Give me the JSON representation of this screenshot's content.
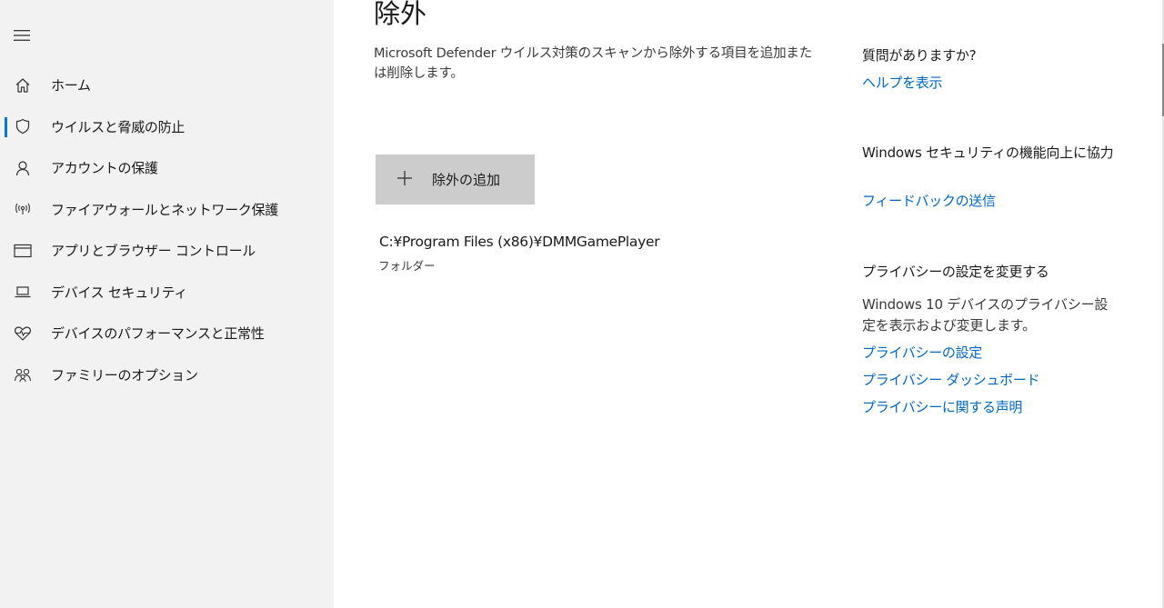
{
  "sidebar": {
    "items": [
      {
        "label": "ホーム",
        "icon": "home-icon",
        "selected": false
      },
      {
        "label": "ウイルスと脅威の防止",
        "icon": "shield-icon",
        "selected": true
      },
      {
        "label": "アカウントの保護",
        "icon": "person-icon",
        "selected": false
      },
      {
        "label": "ファイアウォールとネットワーク保護",
        "icon": "wireless-icon",
        "selected": false
      },
      {
        "label": "アプリとブラウザー コントロール",
        "icon": "app-window-icon",
        "selected": false
      },
      {
        "label": "デバイス セキュリティ",
        "icon": "laptop-icon",
        "selected": false
      },
      {
        "label": "デバイスのパフォーマンスと正常性",
        "icon": "heart-pulse-icon",
        "selected": false
      },
      {
        "label": "ファミリーのオプション",
        "icon": "family-icon",
        "selected": false
      }
    ]
  },
  "main": {
    "title": "除外",
    "description": "Microsoft Defender ウイルス対策のスキャンから除外する項目を追加または削除します。",
    "add_button_label": "除外の追加",
    "exclusions": [
      {
        "path": "C:¥Program Files (x86)¥DMMGamePlayer",
        "type": "フォルダー"
      }
    ]
  },
  "right_panel": {
    "question_heading": "質問がありますか?",
    "help_link": "ヘルプを表示",
    "improve_heading": "Windows セキュリティの機能向上に協力",
    "feedback_link": "フィードバックの送信",
    "privacy_heading": "プライバシーの設定を変更する",
    "privacy_text": "Windows 10 デバイスのプライバシー設定を表示および変更します。",
    "privacy_settings_link": "プライバシーの設定",
    "privacy_dashboard_link": "プライバシー ダッシュボード",
    "privacy_statement_link": "プライバシーに関する声明"
  },
  "colors": {
    "accent": "#0078d4",
    "link": "#0067c0",
    "sidebar_bg": "#f2f2f2",
    "button_bg": "#cccccc"
  }
}
